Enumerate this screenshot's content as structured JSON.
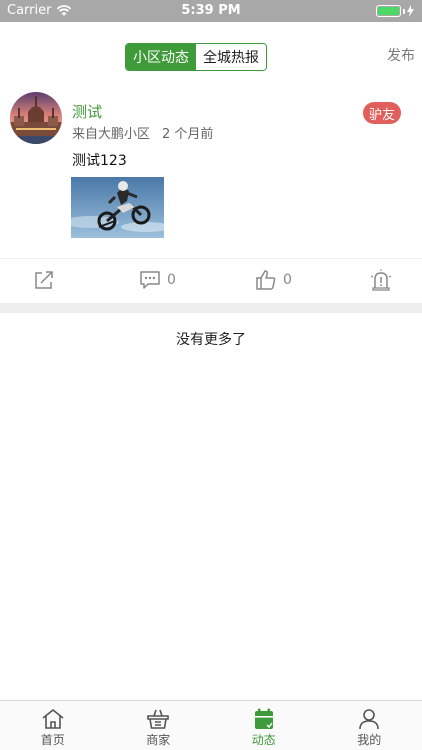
{
  "status_bar": {
    "carrier": "Carrier",
    "time": "5:39 PM",
    "battery_level": 1.0,
    "battery_color": "#4cd964"
  },
  "nav": {
    "segments": [
      {
        "label": "小区动态",
        "active": true
      },
      {
        "label": "全城热报",
        "active": false
      }
    ],
    "publish_label": "发布",
    "accent_color": "#3f9a3a"
  },
  "post": {
    "username": "测试",
    "source": "来自大鹏小区",
    "time_ago": "2 个月前",
    "tag": "驴友",
    "content": "测试123",
    "actions": {
      "share_icon": "share-icon",
      "comment_count": "0",
      "like_count": "0",
      "report_icon": "alarm-icon"
    }
  },
  "list_footer": "没有更多了",
  "tab_bar": {
    "items": [
      {
        "label": "首页",
        "icon": "home-icon",
        "active": false
      },
      {
        "label": "商家",
        "icon": "shop-basket-icon",
        "active": false
      },
      {
        "label": "动态",
        "icon": "calendar-icon",
        "active": true
      },
      {
        "label": "我的",
        "icon": "user-icon",
        "active": false
      }
    ]
  }
}
